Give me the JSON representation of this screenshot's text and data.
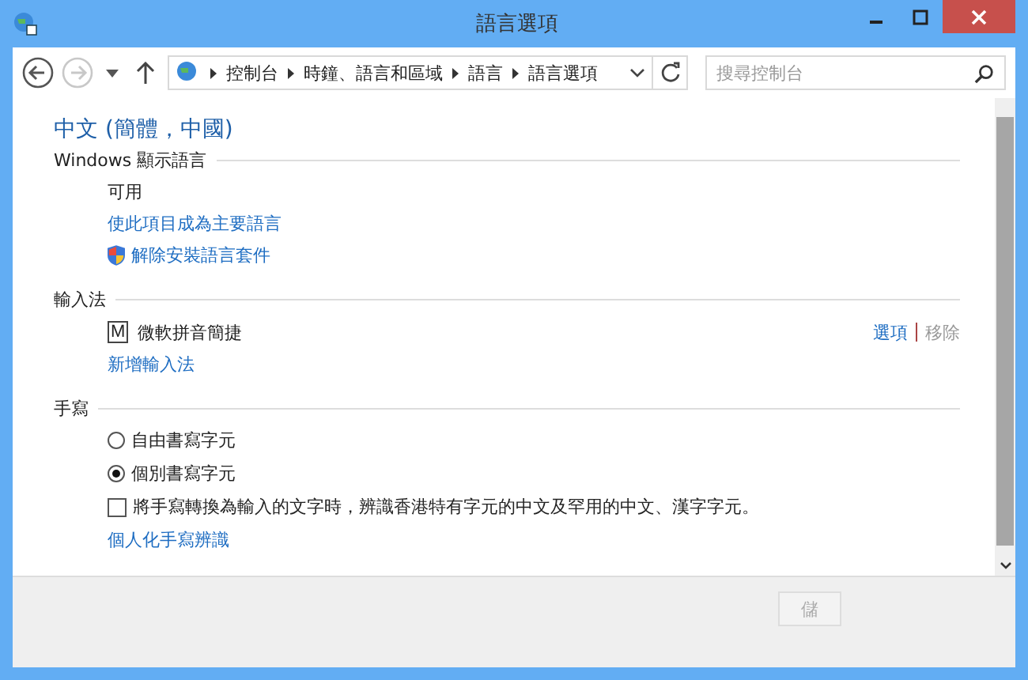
{
  "window": {
    "title": "語言選項"
  },
  "nav": {
    "back_disabled": false,
    "forward_disabled": true,
    "breadcrumb": [
      "控制台",
      "時鐘、語言和區域",
      "語言",
      "語言選項"
    ],
    "search": {
      "placeholder": "搜尋控制台"
    }
  },
  "language": {
    "name": "中文 (簡體，中國)"
  },
  "display_section": {
    "heading": "Windows 顯示語言",
    "status": "可用",
    "links": [
      {
        "label": "使此項目成為主要語言",
        "shield": false
      },
      {
        "label": "解除安裝語言套件",
        "shield": true
      }
    ]
  },
  "ime_section": {
    "heading": "輸入法",
    "methods": [
      {
        "name": "微軟拼音簡捷",
        "icon": "M",
        "actions": [
          {
            "label": "選項",
            "disabled": false
          },
          {
            "label": "移除",
            "disabled": true
          }
        ]
      }
    ],
    "add_link": "新增輸入法"
  },
  "handwriting_section": {
    "heading": "手寫",
    "options": [
      {
        "kind": "radio",
        "label": "自由書寫字元",
        "selected": false
      },
      {
        "kind": "radio",
        "label": "個別書寫字元",
        "selected": true
      },
      {
        "kind": "checkbox",
        "label": "將手寫轉換為輸入的文字時，辨識香港特有字元的中文及罕用的中文、漢字字元。",
        "checked": false
      }
    ],
    "link": "個人化手寫辨識"
  },
  "footer": {
    "buttons": [
      {
        "label": "儲",
        "disabled": true
      }
    ]
  }
}
